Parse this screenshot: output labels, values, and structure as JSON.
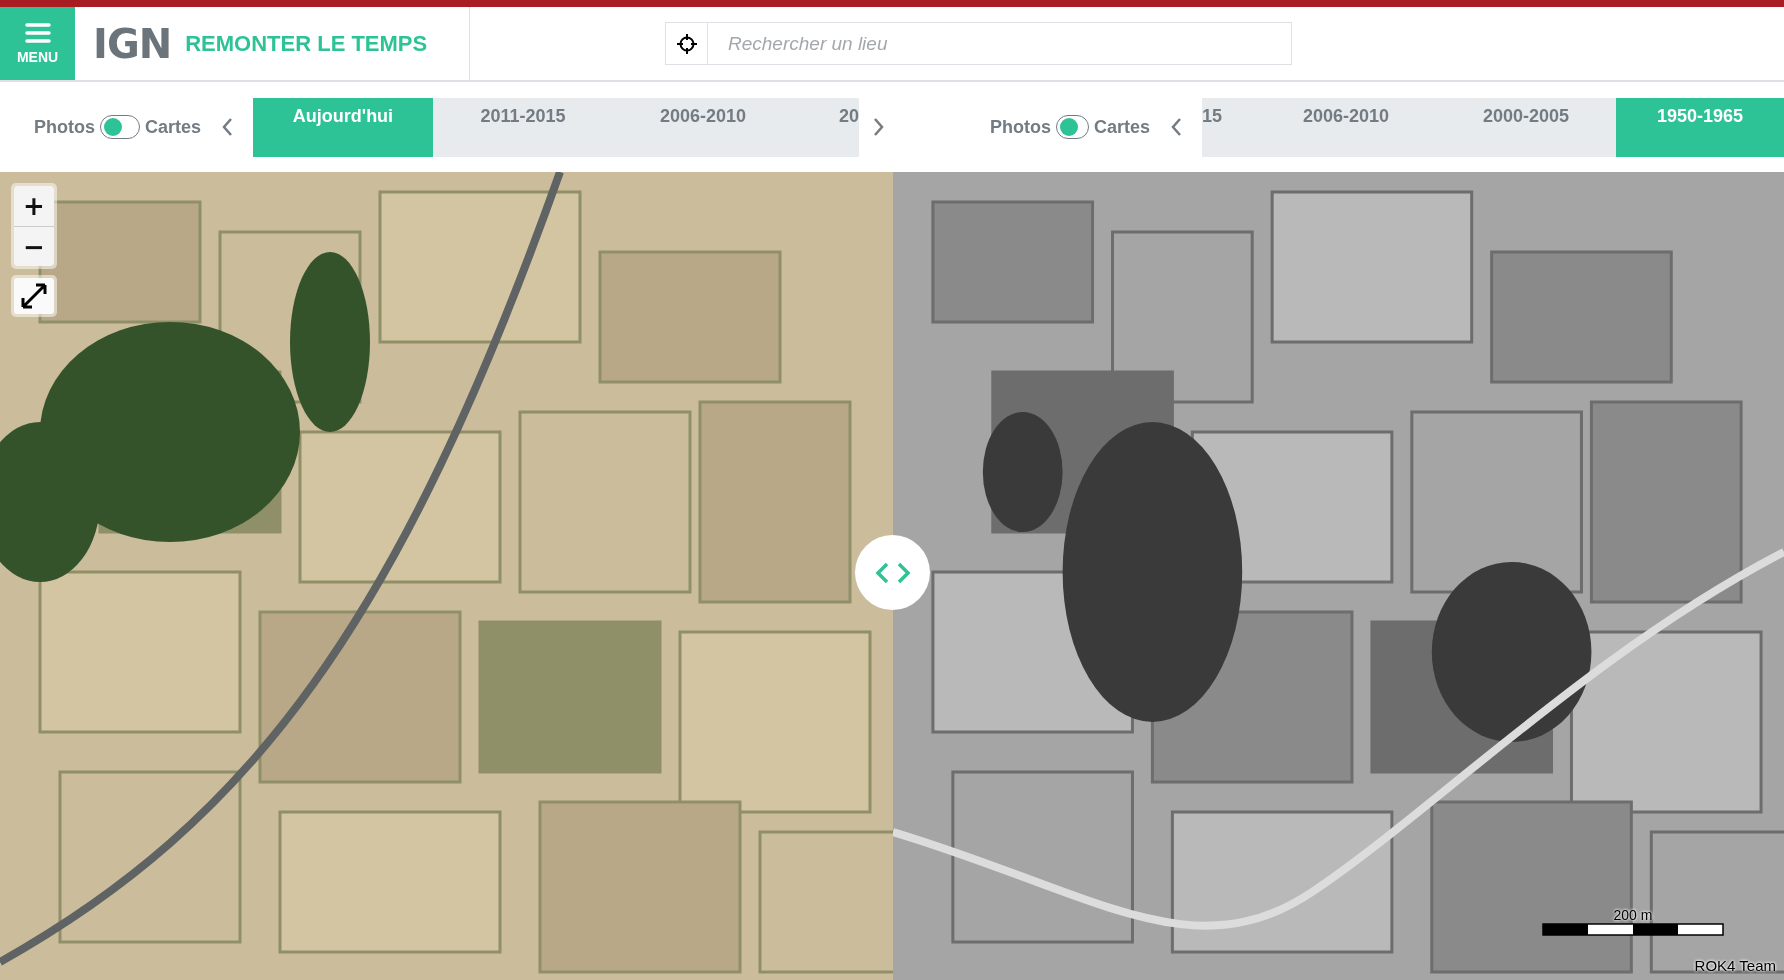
{
  "header": {
    "menu_label": "MENU",
    "logo": "IGN",
    "title": "REMONTER LE TEMPS",
    "search": {
      "placeholder": "Rechercher un lieu"
    }
  },
  "panels": [
    {
      "layer_toggle": {
        "left_label": "Photos",
        "right_label": "Cartes",
        "maps_on": false
      },
      "tabs": [
        {
          "label": "Aujourd'hui",
          "selected": true,
          "kind": "full"
        },
        {
          "label": "2011-2015",
          "selected": false,
          "kind": "full"
        },
        {
          "label": "2006-2010",
          "selected": false,
          "kind": "full"
        },
        {
          "label": "20",
          "selected": false,
          "kind": "cut_end"
        }
      ]
    },
    {
      "layer_toggle": {
        "left_label": "Photos",
        "right_label": "Cartes",
        "maps_on": false
      },
      "tabs": [
        {
          "label": "15",
          "selected": false,
          "kind": "cut_start"
        },
        {
          "label": "2006-2010",
          "selected": false,
          "kind": "full"
        },
        {
          "label": "2000-2005",
          "selected": false,
          "kind": "full"
        },
        {
          "label": "1950-1965",
          "selected": true,
          "kind": "full"
        }
      ]
    }
  ],
  "map": {
    "zoom_in": "+",
    "zoom_out": "−",
    "scale_label": "200 m",
    "attribution": "ROK4 Team"
  }
}
